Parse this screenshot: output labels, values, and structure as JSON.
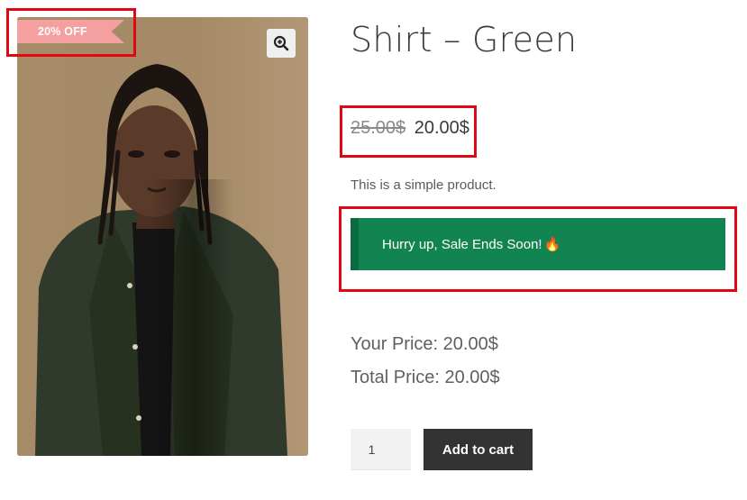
{
  "product": {
    "sale_badge": "20% OFF",
    "title": "Shirt – Green",
    "regular_price": "25.00$",
    "sale_price": "20.00$",
    "short_description": "This is a simple product.",
    "notice_text": "Hurry up, Sale Ends Soon! ",
    "notice_emoji": "🔥",
    "your_price": "Your Price: 20.00$",
    "total_price": "Total Price: 20.00$"
  },
  "cart": {
    "quantity": "1",
    "add_to_cart_label": "Add to cart"
  },
  "colors": {
    "badge": "#f4a0a0",
    "notice": "#128452",
    "notice_border": "#0c6a40",
    "button": "#333333",
    "annotation": "#e30613"
  },
  "icons": {
    "zoom": "magnifier-plus-icon",
    "fire": "fire-icon"
  }
}
